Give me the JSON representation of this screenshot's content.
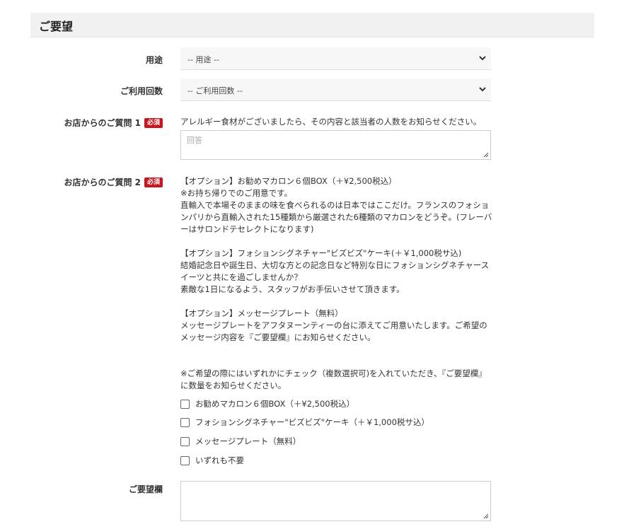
{
  "section": {
    "title": "ご要望"
  },
  "usage": {
    "label": "用途",
    "value": "-- 用途 --"
  },
  "frequency": {
    "label": "ご利用回数",
    "value": "-- ご利用回数 --"
  },
  "required_badge": "必須",
  "question1": {
    "label": "お店からのご質問 1",
    "text": "アレルギー食材がございましたら、その内容と該当者の人数をお知らせください。",
    "placeholder": "回答"
  },
  "question2": {
    "label": "お店からのご質問 2",
    "paragraphs": [
      "【オプション】お勧めマカロン６個BOX（＋¥2,500税込）",
      "※お持ち帰りでのご用意です。",
      "直輸入で本場そのままの味を食べられるのは日本ではここだけ。フランスのフォションパリから直輸入された15種類から厳選された6種類のマカロンをどうぞ。(フレーバーはサロンドテセレクトになります)",
      "【オプション】フォションシグネチャー\"ビズビズ\"ケーキ(＋￥1,000税サ込)",
      "結婚記念日や誕生日、大切な方との記念日など特別な日にフォションシグネチャースイーツと共にを過ごしませんか？",
      "素敵な1日になるよう、スタッフがお手伝いさせて頂きます。",
      "【オプション】メッセージプレート（無料）",
      "メッセージプレートをアフタヌーンティーの台に添えてご用意いたします。ご希望のメッセージ内容を『ご要望欄』にお知らせください。",
      "※ご希望の際にはいずれかにチェック（複数選択可)を入れていただき、『ご要望欄』に数量をお知らせください。"
    ],
    "options": [
      "お勧めマカロン６個BOX（＋¥2,500税込）",
      "フォションシグネチャー\"ビズビズ\"ケーキ（＋￥1,000税サ込）",
      "メッセージプレート（無料）",
      "いずれも不要"
    ]
  },
  "request": {
    "label": "ご要望欄"
  },
  "icons": {
    "select": "chevron-down-icon",
    "resize": "resize-grip-icon",
    "checkbox": "checkbox-icon"
  },
  "colors": {
    "badge": "#c8161e",
    "header_bg": "#f1f1f1"
  }
}
